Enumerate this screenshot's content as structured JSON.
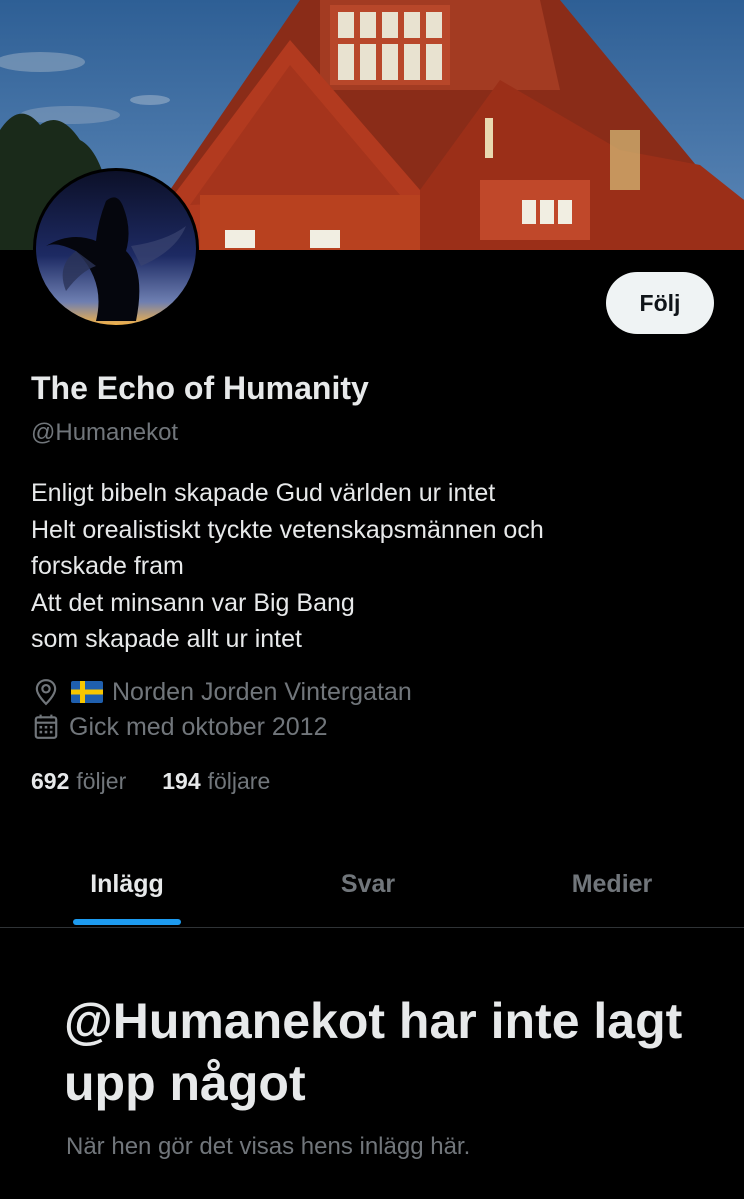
{
  "profile": {
    "display_name": "The Echo of Humanity",
    "handle": "@Humanekot",
    "follow_label": "Följ",
    "bio_lines": [
      "Enligt bibeln skapade Gud världen ur intet",
      "Helt orealistiskt tyckte vetenskapsmännen och",
      "forskade fram",
      "Att det minsann var Big Bang",
      "som skapade allt ur intet"
    ],
    "location": "Norden Jorden Vintergatan",
    "joined": "Gick med oktober 2012",
    "following_count": "692",
    "following_label": "följer",
    "followers_count": "194",
    "followers_label": "följare"
  },
  "tabs": [
    {
      "label": "Inlägg",
      "active": true
    },
    {
      "label": "Svar",
      "active": false
    },
    {
      "label": "Medier",
      "active": false
    }
  ],
  "empty_state": {
    "title": "@Humanekot har inte lagt upp något",
    "subtitle": "När hen gör det visas hens inlägg här."
  },
  "icons": {
    "location": "location-pin-icon",
    "flag": "sweden-flag-icon",
    "calendar": "calendar-icon"
  },
  "colors": {
    "background": "#000000",
    "text_primary": "#e7e9ea",
    "text_secondary": "#71767b",
    "accent": "#1d9bf0",
    "follow_bg": "#eff3f4"
  }
}
